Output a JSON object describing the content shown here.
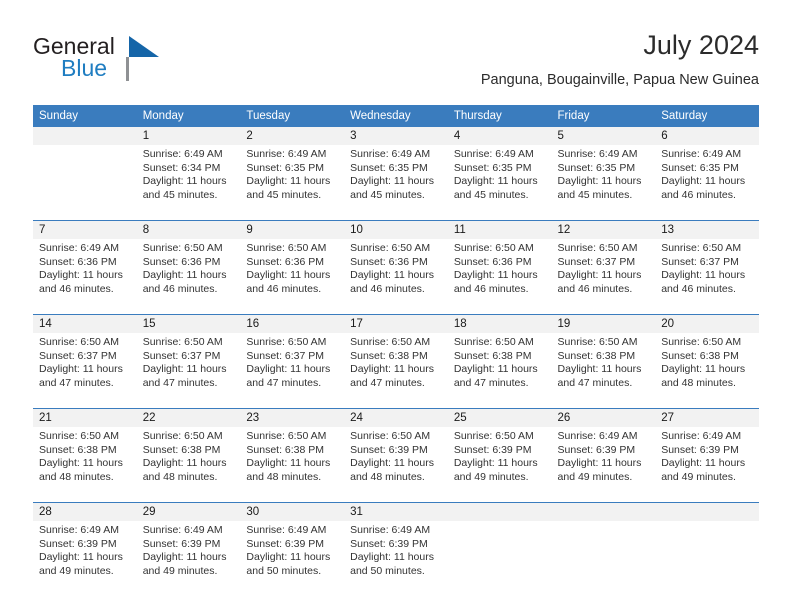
{
  "logo": {
    "word_top": "General",
    "word_bottom": "Blue",
    "accent_color": "#1565a8",
    "text_color": "#231f20",
    "blue_text_color": "#1f7dc1"
  },
  "header": {
    "title": "July 2024",
    "subtitle": "Panguna, Bougainville, Papua New Guinea"
  },
  "calendar": {
    "header_bg": "#3a7cbe",
    "daynum_bg": "#f2f2f2",
    "weekday_headers": [
      "Sunday",
      "Monday",
      "Tuesday",
      "Wednesday",
      "Thursday",
      "Friday",
      "Saturday"
    ],
    "weeks": [
      [
        {
          "day": "",
          "lines": []
        },
        {
          "day": "1",
          "lines": [
            "Sunrise: 6:49 AM",
            "Sunset: 6:34 PM",
            "Daylight: 11 hours",
            "and 45 minutes."
          ]
        },
        {
          "day": "2",
          "lines": [
            "Sunrise: 6:49 AM",
            "Sunset: 6:35 PM",
            "Daylight: 11 hours",
            "and 45 minutes."
          ]
        },
        {
          "day": "3",
          "lines": [
            "Sunrise: 6:49 AM",
            "Sunset: 6:35 PM",
            "Daylight: 11 hours",
            "and 45 minutes."
          ]
        },
        {
          "day": "4",
          "lines": [
            "Sunrise: 6:49 AM",
            "Sunset: 6:35 PM",
            "Daylight: 11 hours",
            "and 45 minutes."
          ]
        },
        {
          "day": "5",
          "lines": [
            "Sunrise: 6:49 AM",
            "Sunset: 6:35 PM",
            "Daylight: 11 hours",
            "and 45 minutes."
          ]
        },
        {
          "day": "6",
          "lines": [
            "Sunrise: 6:49 AM",
            "Sunset: 6:35 PM",
            "Daylight: 11 hours",
            "and 46 minutes."
          ]
        }
      ],
      [
        {
          "day": "7",
          "lines": [
            "Sunrise: 6:49 AM",
            "Sunset: 6:36 PM",
            "Daylight: 11 hours",
            "and 46 minutes."
          ]
        },
        {
          "day": "8",
          "lines": [
            "Sunrise: 6:50 AM",
            "Sunset: 6:36 PM",
            "Daylight: 11 hours",
            "and 46 minutes."
          ]
        },
        {
          "day": "9",
          "lines": [
            "Sunrise: 6:50 AM",
            "Sunset: 6:36 PM",
            "Daylight: 11 hours",
            "and 46 minutes."
          ]
        },
        {
          "day": "10",
          "lines": [
            "Sunrise: 6:50 AM",
            "Sunset: 6:36 PM",
            "Daylight: 11 hours",
            "and 46 minutes."
          ]
        },
        {
          "day": "11",
          "lines": [
            "Sunrise: 6:50 AM",
            "Sunset: 6:36 PM",
            "Daylight: 11 hours",
            "and 46 minutes."
          ]
        },
        {
          "day": "12",
          "lines": [
            "Sunrise: 6:50 AM",
            "Sunset: 6:37 PM",
            "Daylight: 11 hours",
            "and 46 minutes."
          ]
        },
        {
          "day": "13",
          "lines": [
            "Sunrise: 6:50 AM",
            "Sunset: 6:37 PM",
            "Daylight: 11 hours",
            "and 46 minutes."
          ]
        }
      ],
      [
        {
          "day": "14",
          "lines": [
            "Sunrise: 6:50 AM",
            "Sunset: 6:37 PM",
            "Daylight: 11 hours",
            "and 47 minutes."
          ]
        },
        {
          "day": "15",
          "lines": [
            "Sunrise: 6:50 AM",
            "Sunset: 6:37 PM",
            "Daylight: 11 hours",
            "and 47 minutes."
          ]
        },
        {
          "day": "16",
          "lines": [
            "Sunrise: 6:50 AM",
            "Sunset: 6:37 PM",
            "Daylight: 11 hours",
            "and 47 minutes."
          ]
        },
        {
          "day": "17",
          "lines": [
            "Sunrise: 6:50 AM",
            "Sunset: 6:38 PM",
            "Daylight: 11 hours",
            "and 47 minutes."
          ]
        },
        {
          "day": "18",
          "lines": [
            "Sunrise: 6:50 AM",
            "Sunset: 6:38 PM",
            "Daylight: 11 hours",
            "and 47 minutes."
          ]
        },
        {
          "day": "19",
          "lines": [
            "Sunrise: 6:50 AM",
            "Sunset: 6:38 PM",
            "Daylight: 11 hours",
            "and 47 minutes."
          ]
        },
        {
          "day": "20",
          "lines": [
            "Sunrise: 6:50 AM",
            "Sunset: 6:38 PM",
            "Daylight: 11 hours",
            "and 48 minutes."
          ]
        }
      ],
      [
        {
          "day": "21",
          "lines": [
            "Sunrise: 6:50 AM",
            "Sunset: 6:38 PM",
            "Daylight: 11 hours",
            "and 48 minutes."
          ]
        },
        {
          "day": "22",
          "lines": [
            "Sunrise: 6:50 AM",
            "Sunset: 6:38 PM",
            "Daylight: 11 hours",
            "and 48 minutes."
          ]
        },
        {
          "day": "23",
          "lines": [
            "Sunrise: 6:50 AM",
            "Sunset: 6:38 PM",
            "Daylight: 11 hours",
            "and 48 minutes."
          ]
        },
        {
          "day": "24",
          "lines": [
            "Sunrise: 6:50 AM",
            "Sunset: 6:39 PM",
            "Daylight: 11 hours",
            "and 48 minutes."
          ]
        },
        {
          "day": "25",
          "lines": [
            "Sunrise: 6:50 AM",
            "Sunset: 6:39 PM",
            "Daylight: 11 hours",
            "and 49 minutes."
          ]
        },
        {
          "day": "26",
          "lines": [
            "Sunrise: 6:49 AM",
            "Sunset: 6:39 PM",
            "Daylight: 11 hours",
            "and 49 minutes."
          ]
        },
        {
          "day": "27",
          "lines": [
            "Sunrise: 6:49 AM",
            "Sunset: 6:39 PM",
            "Daylight: 11 hours",
            "and 49 minutes."
          ]
        }
      ],
      [
        {
          "day": "28",
          "lines": [
            "Sunrise: 6:49 AM",
            "Sunset: 6:39 PM",
            "Daylight: 11 hours",
            "and 49 minutes."
          ]
        },
        {
          "day": "29",
          "lines": [
            "Sunrise: 6:49 AM",
            "Sunset: 6:39 PM",
            "Daylight: 11 hours",
            "and 49 minutes."
          ]
        },
        {
          "day": "30",
          "lines": [
            "Sunrise: 6:49 AM",
            "Sunset: 6:39 PM",
            "Daylight: 11 hours",
            "and 50 minutes."
          ]
        },
        {
          "day": "31",
          "lines": [
            "Sunrise: 6:49 AM",
            "Sunset: 6:39 PM",
            "Daylight: 11 hours",
            "and 50 minutes."
          ]
        },
        {
          "day": "",
          "lines": []
        },
        {
          "day": "",
          "lines": []
        },
        {
          "day": "",
          "lines": []
        }
      ]
    ]
  }
}
